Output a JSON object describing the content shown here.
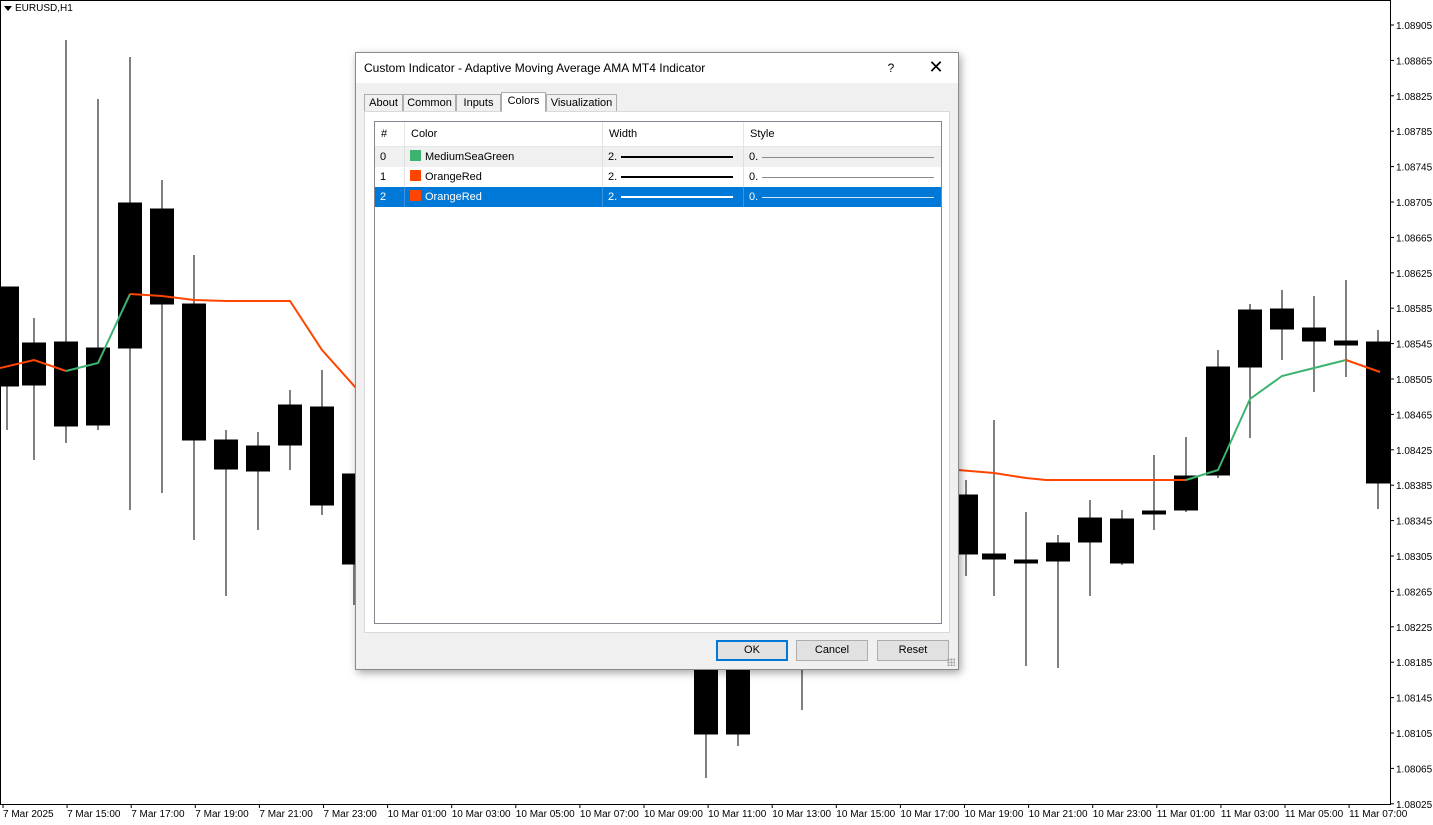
{
  "chart": {
    "symbol": "EURUSD,H1",
    "price_labels": [
      "1.08905",
      "1.08865",
      "1.08825",
      "1.08785",
      "1.08745",
      "1.08705",
      "1.08665",
      "1.08625",
      "1.08585",
      "1.08545",
      "1.08505",
      "1.08465",
      "1.08425",
      "1.08385",
      "1.08345",
      "1.08305",
      "1.08265",
      "1.08225",
      "1.08185",
      "1.08145",
      "1.08105",
      "1.08065",
      "1.08025"
    ],
    "time_labels": [
      "7 Mar 2025",
      "7 Mar 15:00",
      "7 Mar 17:00",
      "7 Mar 19:00",
      "7 Mar 21:00",
      "7 Mar 23:00",
      "10 Mar 01:00",
      "10 Mar 03:00",
      "10 Mar 05:00",
      "10 Mar 07:00",
      "10 Mar 09:00",
      "10 Mar 11:00",
      "10 Mar 13:00",
      "10 Mar 15:00",
      "10 Mar 17:00",
      "10 Mar 19:00",
      "10 Mar 21:00",
      "10 Mar 23:00",
      "11 Mar 01:00",
      "11 Mar 03:00",
      "11 Mar 05:00",
      "11 Mar 07:00"
    ],
    "colors": {
      "up_line": "MediumSeaGreen",
      "down_line": "OrangeRed"
    }
  },
  "dialog": {
    "title": "Custom Indicator - Adaptive Moving Average AMA MT4 Indicator",
    "help": "?",
    "close": "✕",
    "tabs": [
      "About",
      "Common",
      "Inputs",
      "Colors",
      "Visualization"
    ],
    "active_tab": "Colors",
    "table": {
      "headers": [
        "#",
        "Color",
        "Width",
        "Style"
      ],
      "rows": [
        {
          "index": "0",
          "color_name": "MediumSeaGreen",
          "swatch": "#3cb371",
          "width": "2.",
          "style": "0."
        },
        {
          "index": "1",
          "color_name": "OrangeRed",
          "swatch": "#ff4500",
          "width": "2.",
          "style": "0."
        },
        {
          "index": "2",
          "color_name": "OrangeRed",
          "swatch": "#ff4500",
          "width": "2.",
          "style": "0."
        }
      ]
    },
    "buttons": {
      "ok": "OK",
      "cancel": "Cancel",
      "reset": "Reset"
    }
  }
}
